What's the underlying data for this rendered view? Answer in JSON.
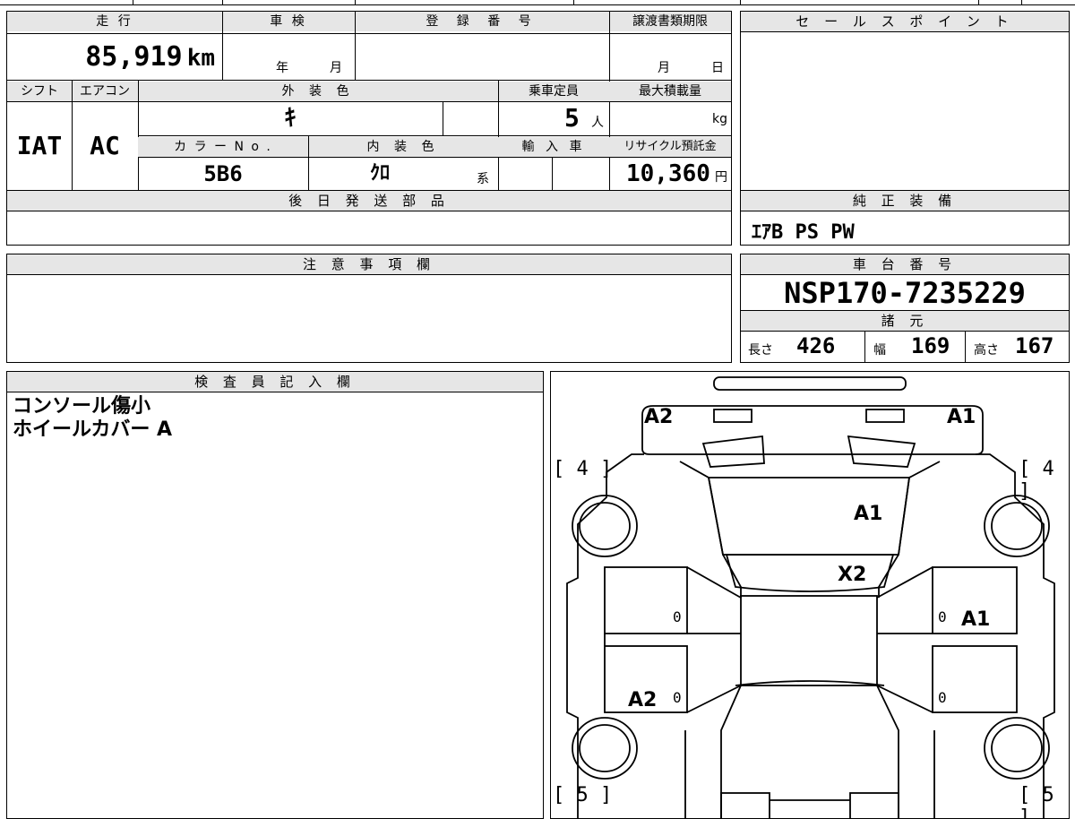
{
  "top": {
    "mileage_label": "走 行",
    "mileage_value": "85,919",
    "mileage_unit": "km",
    "inspection_label": "車 検",
    "inspection_year_unit": "年",
    "inspection_month_unit": "月",
    "registration_label": "登 録 番 号",
    "transfer_deadline_label": "譲渡書類期限",
    "transfer_month_unit": "月",
    "transfer_day_unit": "日",
    "shift_label": "シフト",
    "shift_value": "IAT",
    "ac_label": "エアコン",
    "ac_value": "AC",
    "exterior_color_label": "外 装 色",
    "exterior_color_value": "ｷ",
    "capacity_label": "乗車定員",
    "capacity_value": "5",
    "capacity_unit": "人",
    "max_load_label": "最大積載量",
    "max_load_unit": "kg",
    "color_no_label": "カ ラ ー N o .",
    "color_no_value": "5B6",
    "interior_color_label": "内 装 色",
    "interior_color_value": "ｸﾛ",
    "interior_color_unit": "系",
    "import_label": "輸 入 車",
    "recycle_label": "リサイクル預託金",
    "recycle_value": "10,360",
    "recycle_unit": "円"
  },
  "sales_point": {
    "label": "セ ー ル ス ポ イ ン ト"
  },
  "later_parts": {
    "label": "後 日 発 送 部 品"
  },
  "genuine_equipment": {
    "label": "純 正 装 備",
    "value": "ｴｱB PS PW"
  },
  "notes": {
    "label": "注 意 事 項 欄"
  },
  "chassis": {
    "label": "車 台 番 号",
    "value": "NSP170-7235229"
  },
  "specs": {
    "label": "諸 元",
    "length_label": "長さ",
    "length_value": "426",
    "width_label": "幅",
    "width_value": "169",
    "height_label": "高さ",
    "height_value": "167"
  },
  "inspector": {
    "label": "検 査 員 記 入 欄",
    "line1": "コンソール傷小",
    "line2": "ホイールカバー A"
  },
  "diagram": {
    "front_left": "A2",
    "front_right": "A1",
    "tire_front_left": "[ 4 ]",
    "tire_front_right": "[ 4 ]",
    "windshield": "A1",
    "roof": "X2",
    "door_front_left": "0",
    "door_front_right": "0",
    "door_front_right_mark": "A1",
    "door_rear_left": "0",
    "door_rear_left_mark": "A2",
    "door_rear_right": "0",
    "tire_rear_left": "[ 5 ]",
    "tire_rear_right": "[ 5 ]"
  }
}
